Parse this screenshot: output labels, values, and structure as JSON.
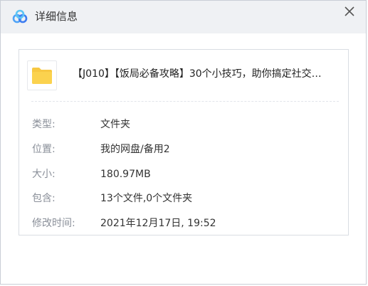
{
  "window": {
    "title": "详细信息"
  },
  "file": {
    "name": "【J010】【饭局必备攻略】30个小技巧，助你搞定社交…"
  },
  "details": [
    {
      "label": "类型:",
      "value": "文件夹"
    },
    {
      "label": "位置:",
      "value": "我的网盘/备用2"
    },
    {
      "label": "大小:",
      "value": "180.97MB"
    },
    {
      "label": "包含:",
      "value": "13个文件,0个文件夹"
    },
    {
      "label": "修改时间:",
      "value": "2021年12月17日, 19:52"
    }
  ],
  "icons": {
    "app": "baidu-netdisk-logo-icon",
    "close": "close-icon",
    "folder": "folder-icon"
  },
  "colors": {
    "folder": "#f7c842",
    "titlebar": "#eff1f4",
    "label": "#8a8f99"
  }
}
